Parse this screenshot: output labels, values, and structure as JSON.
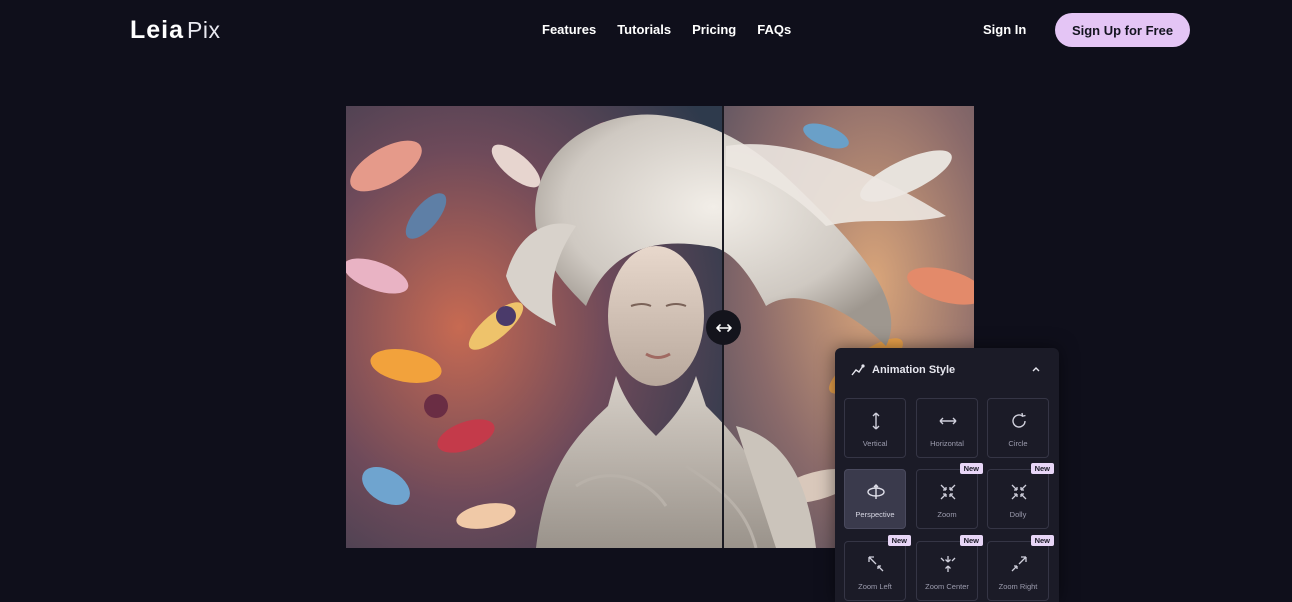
{
  "brand": {
    "name_main": "Leia",
    "name_suffix": "Pix"
  },
  "nav": {
    "items": [
      "Features",
      "Tutorials",
      "Pricing",
      "FAQs"
    ]
  },
  "auth": {
    "signin_label": "Sign In",
    "signup_label": "Sign Up for Free"
  },
  "compare": {
    "handle_icon": "left-right-arrow-icon"
  },
  "panel": {
    "title": "Animation Style",
    "icon": "animation-path-icon",
    "collapse_icon": "chevron-up-icon",
    "options": [
      {
        "label": "Vertical",
        "icon": "vertical-arrows-icon",
        "badge": "",
        "active": false
      },
      {
        "label": "Horizontal",
        "icon": "horizontal-arrows-icon",
        "badge": "",
        "active": false
      },
      {
        "label": "Circle",
        "icon": "circle-arrow-icon",
        "badge": "",
        "active": false
      },
      {
        "label": "Perspective",
        "icon": "perspective-icon",
        "badge": "",
        "active": true
      },
      {
        "label": "Zoom",
        "icon": "zoom-icon",
        "badge": "New",
        "active": false
      },
      {
        "label": "Dolly",
        "icon": "dolly-icon",
        "badge": "New",
        "active": false
      },
      {
        "label": "Zoom Left",
        "icon": "zoom-left-icon",
        "badge": "New",
        "active": false
      },
      {
        "label": "Zoom Center",
        "icon": "zoom-center-icon",
        "badge": "New",
        "active": false
      },
      {
        "label": "Zoom Right",
        "icon": "zoom-right-icon",
        "badge": "New",
        "active": false
      }
    ]
  },
  "colors": {
    "background": "#0f0f1b",
    "accent": "#e4c5f5",
    "panel": "#1b1b27"
  }
}
